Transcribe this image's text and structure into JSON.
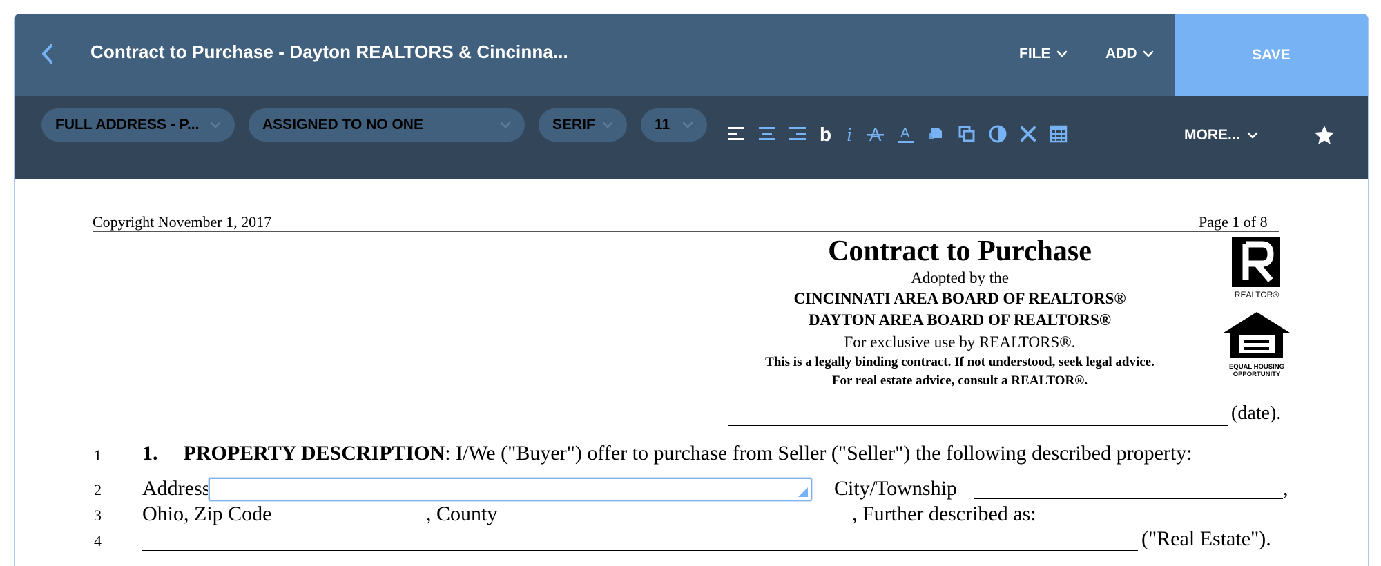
{
  "header": {
    "title": "Contract to Purchase - Dayton REALTORS & Cincinna...",
    "file_label": "FILE",
    "add_label": "ADD",
    "save_label": "SAVE"
  },
  "toolbar": {
    "field_select": "FULL ADDRESS - P...",
    "assignee_select": "ASSIGNED TO NO ONE",
    "font_select": "SERIF",
    "size_select": "11",
    "more_label": "MORE...",
    "icons": [
      "align-left-icon",
      "align-center-icon",
      "align-right-icon",
      "bold-icon",
      "italic-icon",
      "strikethrough-icon",
      "text-color-icon",
      "fill-icon",
      "copy-icon",
      "contrast-icon",
      "delete-icon",
      "table-icon",
      "star-icon"
    ],
    "colors": {
      "header_bg": "#41607d",
      "toolbar_bg": "#334659",
      "accent": "#77b3f4"
    }
  },
  "document": {
    "copyright": "Copyright November 1, 2017",
    "page_label": "Page 1 of 8",
    "title": "Contract to Purchase",
    "adopted": "Adopted by the",
    "board1": "CINCINNATI AREA BOARD OF REALTORS®",
    "board2": "DAYTON AREA BOARD OF REALTORS®",
    "exclusive": "For exclusive use by REALTORS®.",
    "binding": "This is a legally binding contract.  If not understood, seek legal advice.",
    "advice": "For real estate advice, consult a REALTOR®.",
    "date_label": "(date).",
    "realtor_logo_text": "REALTOR®",
    "eho_text": "EQUAL HOUSING OPPORTUNITY",
    "lines": {
      "n1": "1",
      "n2": "2",
      "n3": "3",
      "n4": "4",
      "section_num": "1.",
      "section_title": "PROPERTY DESCRIPTION",
      "section_text": ":  I/We (\"Buyer\") offer to purchase from Seller (\"Seller\") the following described property:",
      "address": "Address",
      "city": "City/Township",
      "comma": ",",
      "ohio_zip": "Ohio,  Zip Code",
      "county": ", County",
      "further": ", Further described as:",
      "real_estate": "(\"Real Estate\")."
    }
  }
}
